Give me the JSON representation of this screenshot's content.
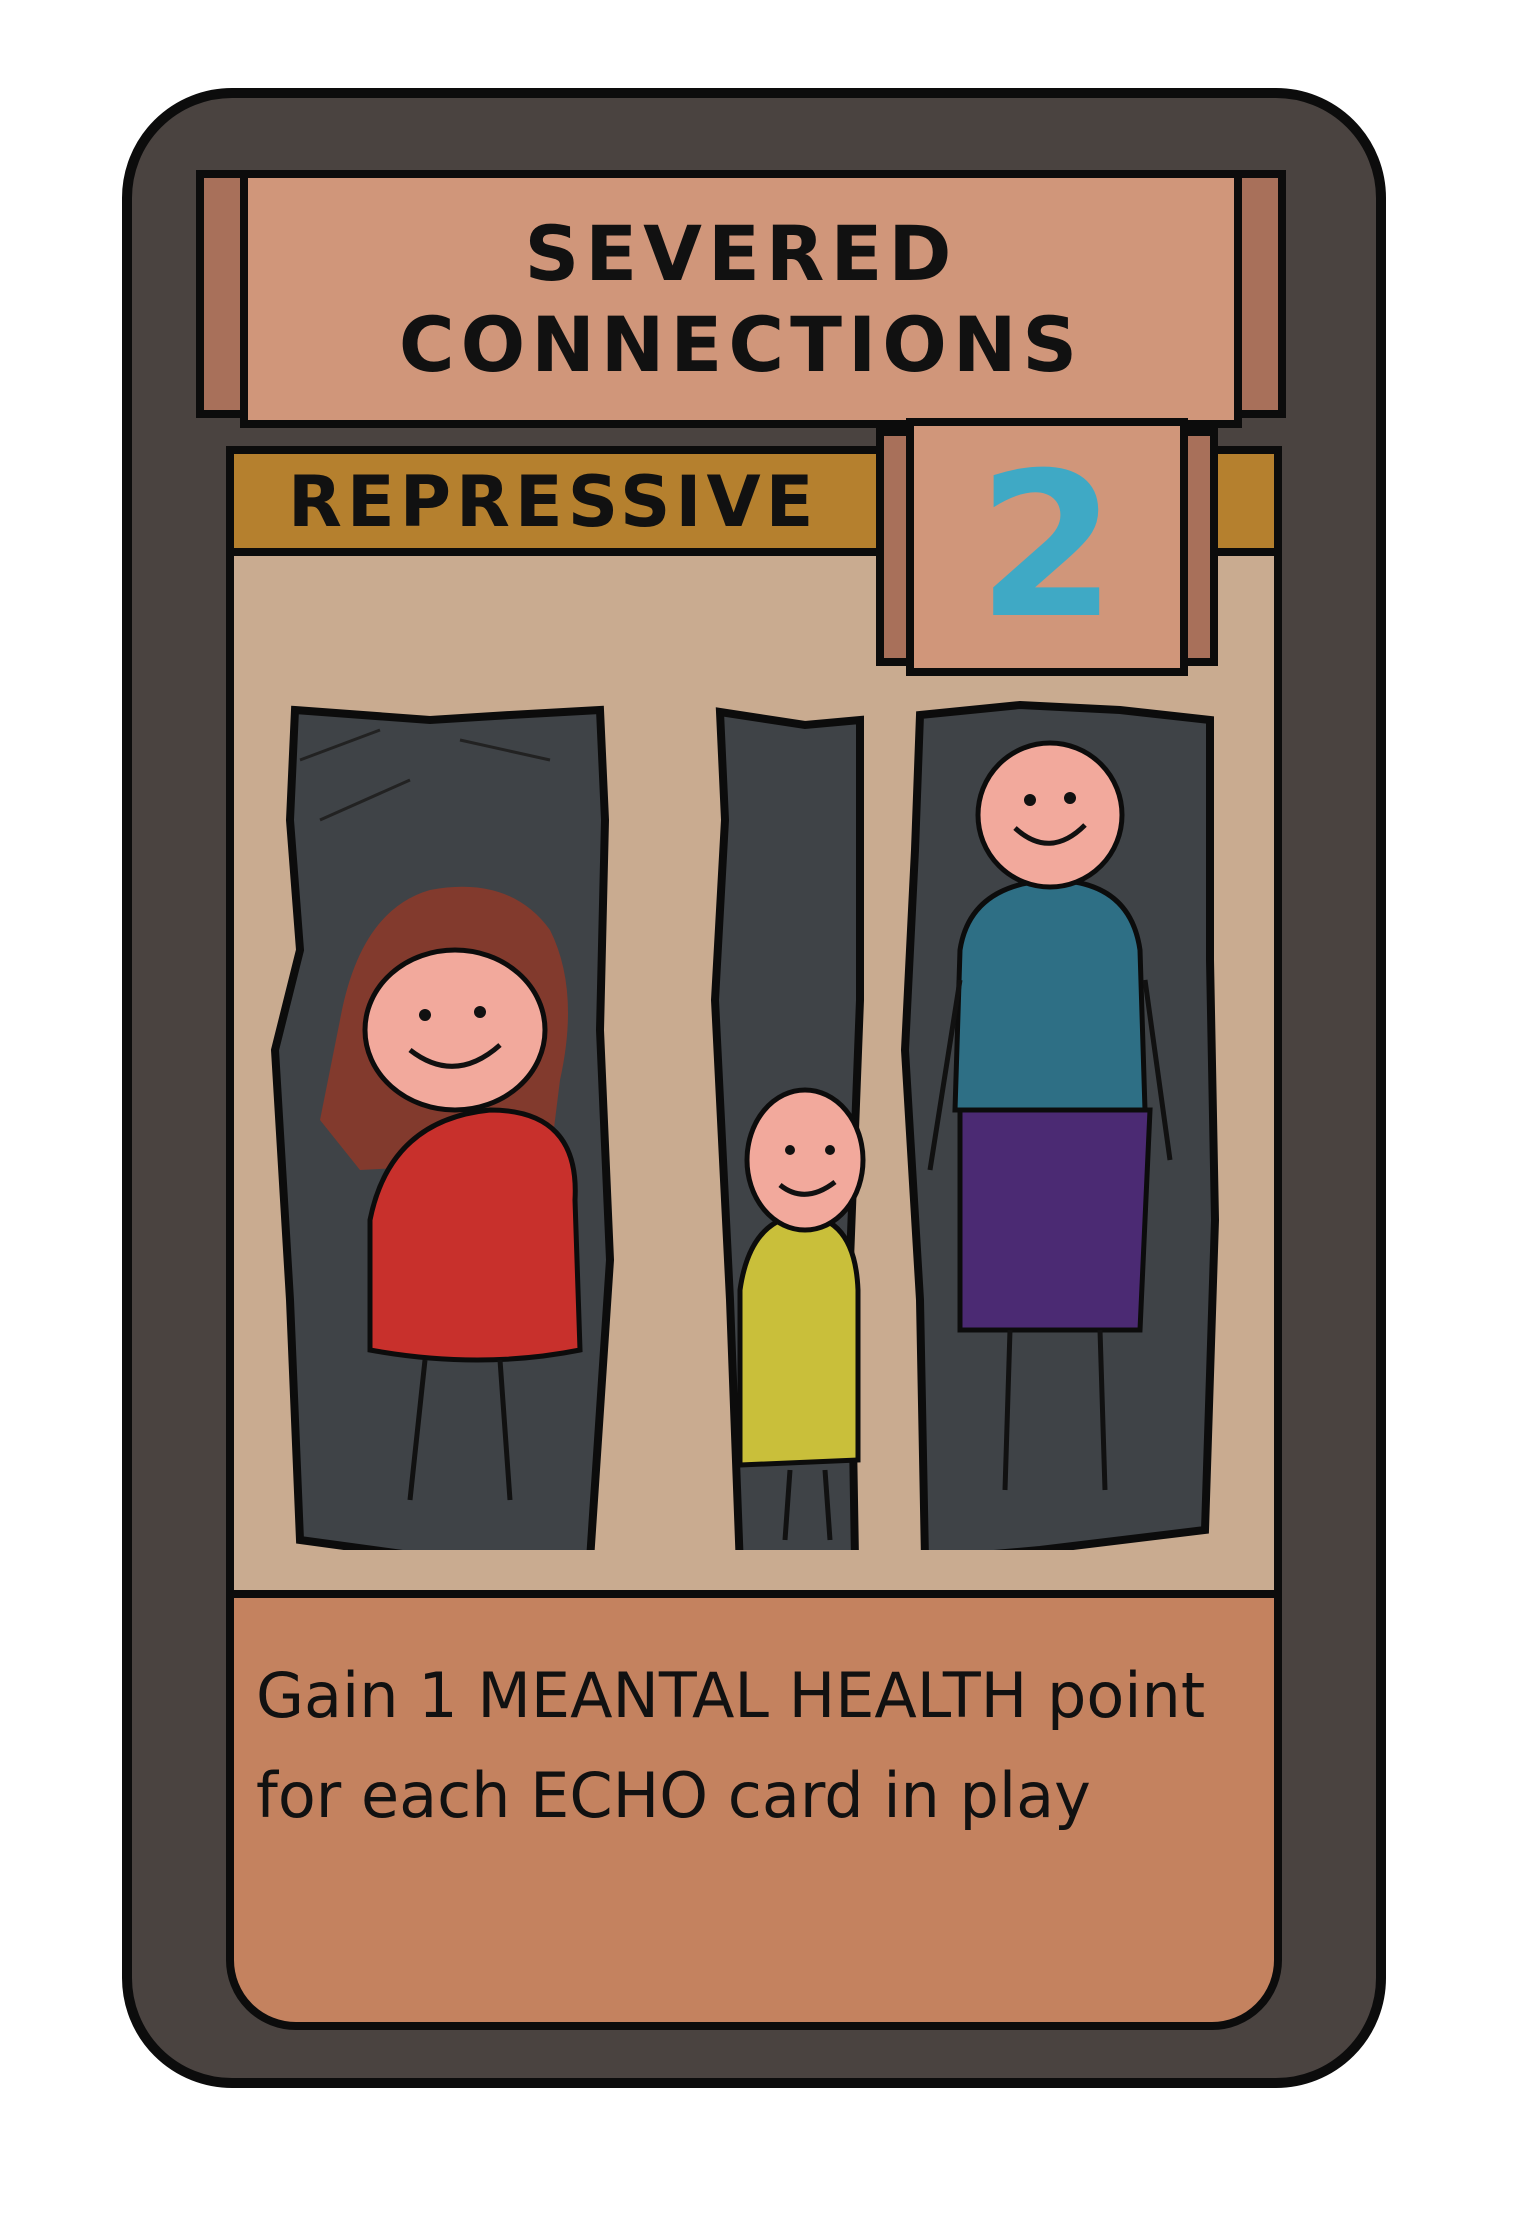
{
  "card": {
    "title_line1": "SEVERED",
    "title_line2": "CONNECTIONS",
    "type": "REPRESSIVE",
    "cost": "2",
    "rules_text": "Gain 1 MEANTAL HEALTH point for each ECHO card in play"
  },
  "colors": {
    "card_border": "#4a4340",
    "title_fill": "#d0967a",
    "title_side_fill": "#a8705a",
    "type_bar": "#b5802e",
    "cost_number": "#3fa9c5",
    "art_background": "#c9ab90",
    "text_box": "#c4825f",
    "figure_woman_shirt": "#c8302c",
    "figure_woman_hair": "#8a3a2a",
    "figure_child_shirt": "#c9bf3a",
    "figure_man_shirt": "#2e6f85",
    "figure_man_pants": "#4b2a73",
    "skin": "#f2a99c",
    "panel_dark": "#3f4347"
  },
  "icons": [
    "woman-figure-icon",
    "child-figure-icon",
    "man-figure-icon"
  ]
}
